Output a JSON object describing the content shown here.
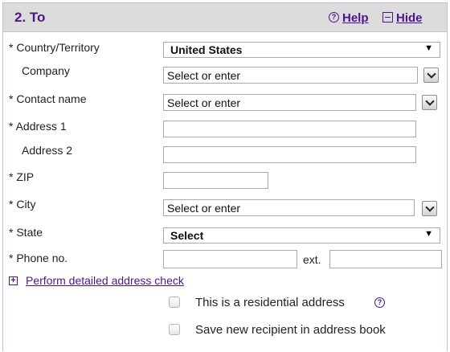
{
  "header": {
    "title": "2. To",
    "help_label": "Help",
    "hide_label": "Hide",
    "help_icon": "question-circle-icon",
    "hide_icon": "collapse-box-icon"
  },
  "form": {
    "country_label": "* Country/Territory",
    "country_value": "United States",
    "company_label": "Company",
    "company_value": "Select or enter",
    "contact_label": "* Contact name",
    "contact_value": "Select or enter",
    "address1_label": "* Address 1",
    "address1_value": "",
    "address2_label": "Address 2",
    "address2_value": "",
    "zip_label": "* ZIP",
    "zip_value": "",
    "city_label": "* City",
    "city_value": "Select or enter",
    "state_label": "* State",
    "state_value": "Select",
    "phone_label": "* Phone no.",
    "phone_value": "",
    "ext_label": "ext.",
    "ext_value": ""
  },
  "address_check": {
    "label": "Perform detailed address check",
    "icon": "expand-plus-icon"
  },
  "options": {
    "residential_label": "This is a residential address",
    "residential_checked": false,
    "save_label": "Save new recipient in address book",
    "save_checked": false
  },
  "colors": {
    "accent": "#4d148c",
    "header_bg": "#dcdcdc",
    "border": "#cdb6d7"
  }
}
